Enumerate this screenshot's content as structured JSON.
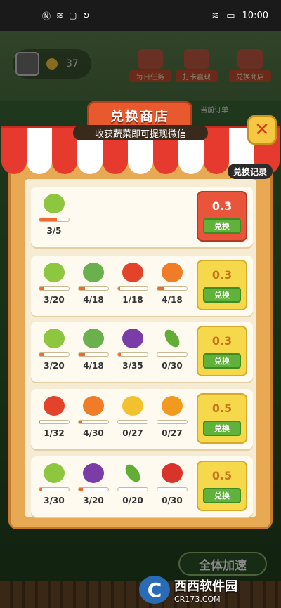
{
  "status_bar": {
    "time": "10:00",
    "left_icons": [
      "nfc-icon",
      "wifi-icon",
      "bag-icon",
      "sync-icon"
    ],
    "right_icons": [
      "wifi-icon",
      "battery-icon"
    ]
  },
  "background": {
    "coins": "37",
    "menu": [
      "每日任务",
      "打卡赢现",
      "兑换商店"
    ],
    "order_label": "当前订单",
    "speed_button": "全体加速"
  },
  "modal": {
    "title": "兑换商店",
    "subtitle": "收获蔬菜即可提现微信",
    "close_icon": "close-icon",
    "record_button": "兑换记录",
    "cards": [
      {
        "items": [
          {
            "icon": "pea",
            "count": "3/5",
            "progress": 0.6
          }
        ],
        "reward": "0.3",
        "button": "兑换",
        "style": "red"
      },
      {
        "items": [
          {
            "icon": "pea",
            "count": "3/20",
            "progress": 0.15
          },
          {
            "icon": "cabbage",
            "count": "4/18",
            "progress": 0.22
          },
          {
            "icon": "tomato",
            "count": "1/18",
            "progress": 0.06
          },
          {
            "icon": "carrot",
            "count": "4/18",
            "progress": 0.22
          }
        ],
        "reward": "0.3",
        "button": "兑换",
        "style": "yellow"
      },
      {
        "items": [
          {
            "icon": "pea",
            "count": "3/20",
            "progress": 0.15
          },
          {
            "icon": "cabbage",
            "count": "4/18",
            "progress": 0.22
          },
          {
            "icon": "eggplant",
            "count": "3/35",
            "progress": 0.09
          },
          {
            "icon": "cucumber",
            "count": "0/30",
            "progress": 0
          }
        ],
        "reward": "0.3",
        "button": "兑换",
        "style": "yellow"
      },
      {
        "items": [
          {
            "icon": "tomato",
            "count": "1/32",
            "progress": 0.03
          },
          {
            "icon": "carrot",
            "count": "4/30",
            "progress": 0.13
          },
          {
            "icon": "corn",
            "count": "0/27",
            "progress": 0
          },
          {
            "icon": "pumpkin",
            "count": "0/27",
            "progress": 0
          }
        ],
        "reward": "0.5",
        "button": "兑换",
        "style": "yellow"
      },
      {
        "items": [
          {
            "icon": "pea",
            "count": "3/30",
            "progress": 0.1
          },
          {
            "icon": "eggplant",
            "count": "3/20",
            "progress": 0.15
          },
          {
            "icon": "cucumber",
            "count": "0/20",
            "progress": 0
          },
          {
            "icon": "pepper",
            "count": "0/30",
            "progress": 0
          }
        ],
        "reward": "0.5",
        "button": "兑换",
        "style": "yellow"
      }
    ]
  },
  "watermark": {
    "logo": "C",
    "main": "西西软件园",
    "sub": "CR173.COM"
  }
}
